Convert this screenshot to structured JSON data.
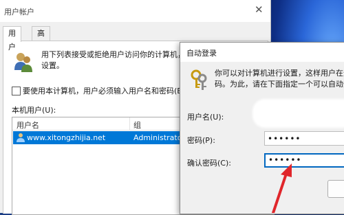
{
  "user_accounts": {
    "title": "用户帐户",
    "close_glyph": "✕",
    "tabs": [
      "用户",
      "高级"
    ],
    "description_lines": [
      "用下列表接受或拒绝用户访问你的计算机，",
      "设置。"
    ],
    "require_password_checkbox": {
      "label": "要使用本计算机，用户必须输入用户名和密码(E)",
      "checked": false
    },
    "local_users_label": "本机用户(U):",
    "table": {
      "columns": [
        "用户名",
        "组"
      ],
      "rows": [
        {
          "username": "www.xitongzhijia.net",
          "group": "Administrators",
          "selected": true
        }
      ]
    }
  },
  "auto_logon_dialog": {
    "title": "自动登录",
    "description_lines": [
      "你可以对计算机进行设置，这样用户在登录",
      "码。为此，请在下面指定一个可以自动登录"
    ],
    "fields": {
      "username_label": "用户名(U):",
      "password_label": "密码(P):",
      "password_value": "••••••",
      "confirm_label": "确认密码(C):",
      "confirm_value": "••••••"
    }
  },
  "colors": {
    "selection": "#0078d7",
    "focus_border": "#0067c0",
    "annotation_arrow": "#e0262b"
  }
}
